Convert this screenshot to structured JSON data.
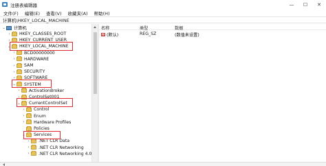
{
  "window": {
    "title": "注册表编辑器",
    "minimize": "—",
    "maximize": "☐",
    "close": "✕"
  },
  "menu": [
    "文件(F)",
    "编辑(E)",
    "查看(V)",
    "收藏夹(A)",
    "帮助(H)"
  ],
  "address": "计算机\\HKEY_LOCAL_MACHINE",
  "tree": {
    "root": "计算机",
    "items": [
      {
        "label": "HKEY_CLASSES_ROOT",
        "expander": "›",
        "level": 1
      },
      {
        "label": "HKEY_CURRENT_USER",
        "expander": "›",
        "level": 1
      },
      {
        "label": "HKEY_LOCAL_MACHINE",
        "expander": "⌄",
        "level": 1
      },
      {
        "label": "BCD00000000",
        "expander": "›",
        "level": 2
      },
      {
        "label": "HARDWARE",
        "expander": "›",
        "level": 2
      },
      {
        "label": "SAM",
        "expander": "›",
        "level": 2
      },
      {
        "label": "SECURITY",
        "expander": "›",
        "level": 2
      },
      {
        "label": "SOFTWARE",
        "expander": "›",
        "level": 2
      },
      {
        "label": "SYSTEM",
        "expander": "⌄",
        "level": 2
      },
      {
        "label": "ActivationBroker",
        "expander": "›",
        "level": 3
      },
      {
        "label": "ControlSet001",
        "expander": "›",
        "level": 3
      },
      {
        "label": "CurrentControlSet",
        "expander": "⌄",
        "level": 3
      },
      {
        "label": "Control",
        "expander": "›",
        "level": 4
      },
      {
        "label": "Enum",
        "expander": "›",
        "level": 4
      },
      {
        "label": "Hardware Profiles",
        "expander": "›",
        "level": 4
      },
      {
        "label": "Policies",
        "expander": "",
        "level": 4
      },
      {
        "label": "Services",
        "expander": "⌄",
        "level": 4
      },
      {
        "label": ".NET CLR Data",
        "expander": "›",
        "level": 5
      },
      {
        "label": ".NET CLR Networking",
        "expander": "›",
        "level": 5
      },
      {
        "label": ".NET CLR Networking 4.0.0",
        "expander": "›",
        "level": 5
      }
    ]
  },
  "list": {
    "columns": [
      "名称",
      "类型",
      "数据"
    ],
    "rows": [
      {
        "name": "(默认)",
        "type": "REG_SZ",
        "data": "(数值未设置)",
        "icon": "ab"
      }
    ]
  },
  "colors": {
    "highlight_box": "#e0282e",
    "folder": "#e8c35a"
  }
}
